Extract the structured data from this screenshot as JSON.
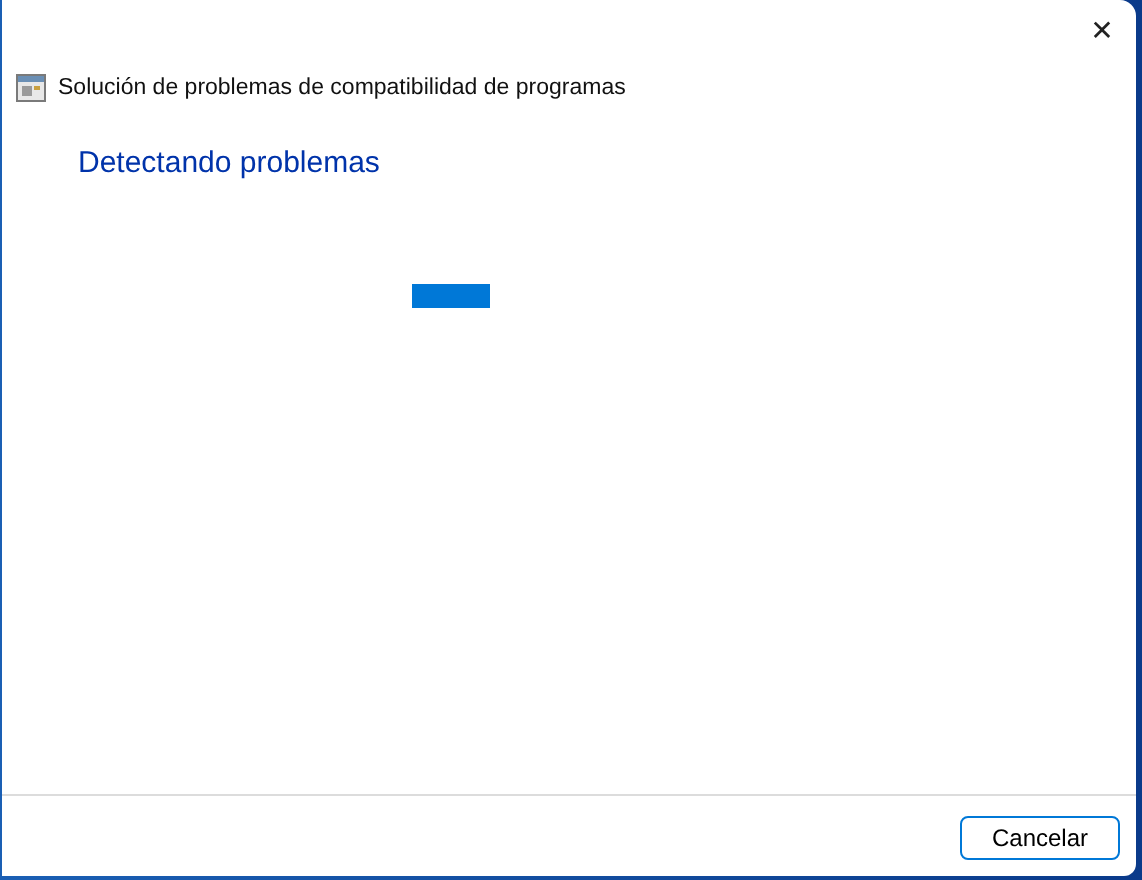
{
  "window": {
    "title": "Solución de problemas de compatibilidad de programas",
    "close": "✕"
  },
  "heading": "Detectando problemas",
  "buttons": [
    {
      "label": "Cancelar"
    }
  ]
}
